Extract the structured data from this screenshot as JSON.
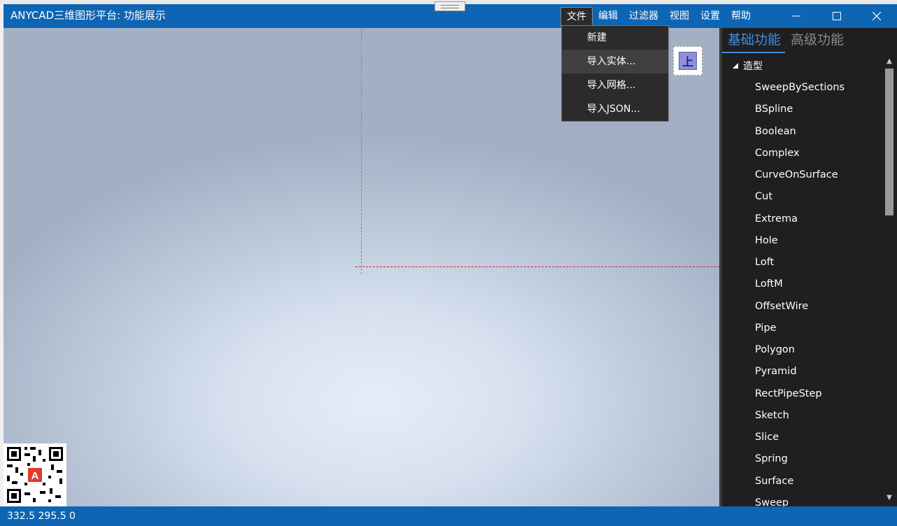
{
  "window": {
    "title": "ANYCAD三维图形平台: 功能展示"
  },
  "menu": {
    "items": [
      "文件",
      "编辑",
      "过滤器",
      "视图",
      "设置",
      "帮助"
    ],
    "file_dropdown": [
      "新建",
      "导入实体...",
      "导入网格...",
      "导入JSON..."
    ]
  },
  "viewcube": {
    "label": "上"
  },
  "panel": {
    "tabs": [
      "基础功能",
      "高级功能"
    ],
    "group": "造型",
    "items": [
      "SweepBySections",
      "BSpline",
      "Boolean",
      "Complex",
      "CurveOnSurface",
      "Cut",
      "Extrema",
      "Hole",
      "Loft",
      "LoftM",
      "OffsetWire",
      "Pipe",
      "Polygon",
      "Pyramid",
      "RectPipeStep",
      "Sketch",
      "Slice",
      "Spring",
      "Surface",
      "Sweep"
    ]
  },
  "status": {
    "coords": "332.5 295.5 0"
  },
  "colors": {
    "accent": "#0e65b4",
    "panel_bg": "#1f1f1f",
    "tab_active": "#3d8fdf",
    "x_axis": "#cc2222",
    "y_axis": "#22cc22"
  },
  "icons": {
    "minimize": "minimize-icon",
    "maximize": "maximize-icon",
    "close": "close-icon",
    "expand": "expand-triangle-icon",
    "qr": "qr-code-icon"
  }
}
